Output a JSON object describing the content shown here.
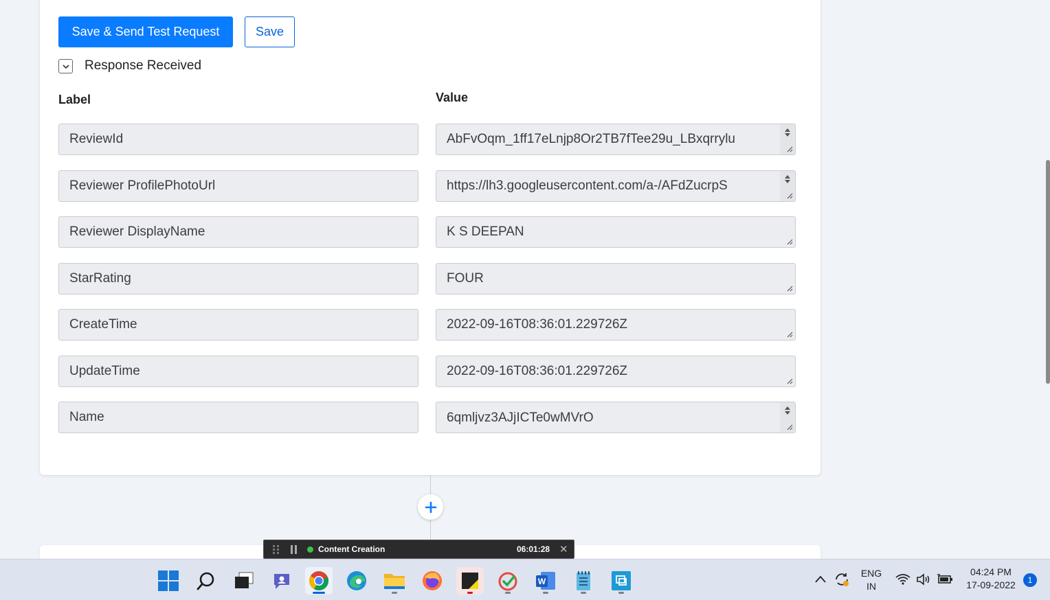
{
  "toolbar": {
    "save_send_label": "Save & Send Test Request",
    "save_label": "Save"
  },
  "response": {
    "section_label": "Response Received",
    "label_header": "Label",
    "value_header": "Value",
    "rows": [
      {
        "label": "ReviewId",
        "value": "AbFvOqm_1ff17eLnjp8Or2TB7fTee29u_LBxqrrylu"
      },
      {
        "label": "Reviewer ProfilePhotoUrl",
        "value": "https://lh3.googleusercontent.com/a-/AFdZucrpS"
      },
      {
        "label": "Reviewer DisplayName",
        "value": "K S DEEPAN"
      },
      {
        "label": "StarRating",
        "value": "FOUR"
      },
      {
        "label": "CreateTime",
        "value": "2022-09-16T08:36:01.229726Z"
      },
      {
        "label": "UpdateTime",
        "value": "2022-09-16T08:36:01.229726Z"
      },
      {
        "label": "Name",
        "value": "6qmljvz3AJjICTe0wMVrO"
      }
    ]
  },
  "recorder": {
    "title": "Content Creation",
    "elapsed": "06:01:28"
  },
  "taskbar": {
    "apps": [
      "windows-start",
      "search",
      "task-view",
      "chat",
      "chrome",
      "edge",
      "file-explorer",
      "firefox",
      "sticky-notes",
      "task-app",
      "word",
      "notepad",
      "remote-desktop"
    ],
    "active_app": "chrome"
  },
  "tray": {
    "lang_primary": "ENG",
    "lang_secondary": "IN",
    "time": "04:24 PM",
    "date": "17-09-2022",
    "notification_count": "1"
  },
  "colors": {
    "accent": "#0a7cff",
    "field_bg": "#ebedf0",
    "page_bg": "#f0f4f8"
  }
}
